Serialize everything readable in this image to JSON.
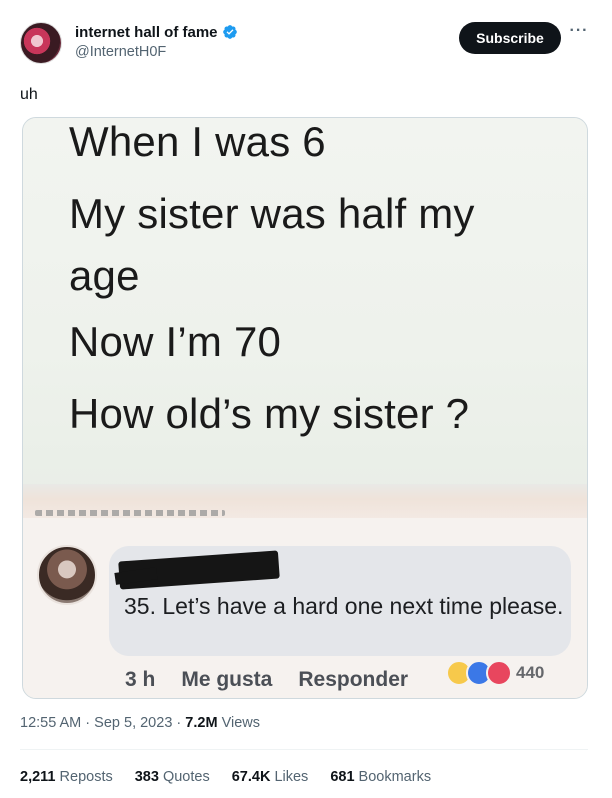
{
  "author": {
    "display_name": "internet hall of fame",
    "handle": "@InternetH0F",
    "verified": true,
    "verified_color": "#1d9bf0"
  },
  "header": {
    "subscribe_label": "Subscribe",
    "more_label": "···"
  },
  "tweet": {
    "text": "uh"
  },
  "media": {
    "lines": [
      "When I was 6",
      "My sister was half my",
      "age",
      "Now I’m 70",
      "How old’s my sister ?"
    ],
    "comment": {
      "text": "35. Let’s have a hard one next time please.",
      "time": "3 h",
      "like_label": "Me gusta",
      "reply_label": "Responder",
      "reaction_count": "440"
    }
  },
  "meta": {
    "time": "12:55 AM",
    "date": "Sep 5, 2023",
    "views_count": "7.2M",
    "views_label": "Views"
  },
  "stats": {
    "reposts_count": "2,211",
    "reposts_label": "Reposts",
    "quotes_count": "383",
    "quotes_label": "Quotes",
    "likes_count": "67.4K",
    "likes_label": "Likes",
    "bookmarks_count": "681",
    "bookmarks_label": "Bookmarks"
  }
}
